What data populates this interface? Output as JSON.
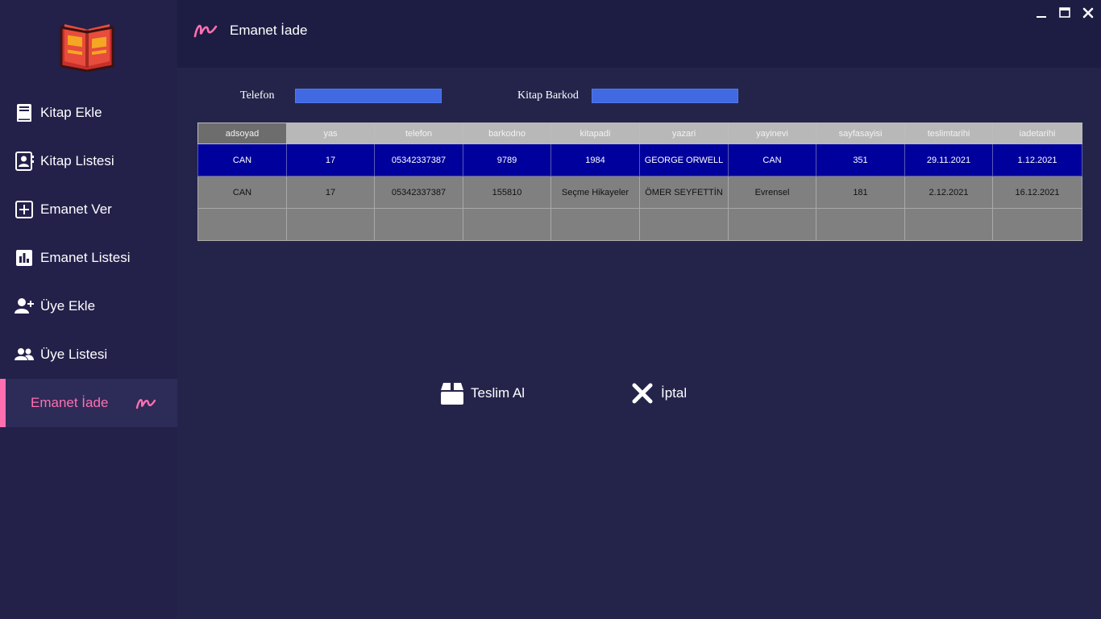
{
  "window": {
    "title": "Emanet İade"
  },
  "sidebar": {
    "items": [
      {
        "label": "Kitap Ekle",
        "icon": "book-icon"
      },
      {
        "label": "Kitap Listesi",
        "icon": "contact-list-icon"
      },
      {
        "label": "Emanet Ver",
        "icon": "plus-square-icon"
      },
      {
        "label": "Emanet Listesi",
        "icon": "bar-chart-icon"
      },
      {
        "label": "Üye Ekle",
        "icon": "user-plus-icon"
      },
      {
        "label": "Üye Listesi",
        "icon": "users-icon"
      },
      {
        "label": "Emanet İade",
        "icon": "squiggle-icon",
        "active": true
      }
    ]
  },
  "form": {
    "telefon_label": "Telefon",
    "telefon_value": "",
    "barkod_label": "Kitap Barkod",
    "barkod_value": ""
  },
  "table": {
    "columns": [
      "adsoyad",
      "yas",
      "telefon",
      "barkodno",
      "kitapadi",
      "yazari",
      "yayinevi",
      "sayfasayisi",
      "teslimtarihi",
      "iadetarihi"
    ],
    "rows": [
      [
        "CAN",
        "17",
        "05342337387",
        "9789",
        "1984",
        "GEORGE ORWELL",
        "CAN",
        "351",
        "29.11.2021",
        "1.12.2021"
      ],
      [
        "CAN",
        "17",
        "05342337387",
        "155810",
        "Seçme Hikayeler",
        "ÖMER SEYFETTİN",
        "Evrensel",
        "181",
        "2.12.2021",
        "16.12.2021"
      ]
    ]
  },
  "actions": {
    "teslim_label": "Teslim Al",
    "iptal_label": "İptal"
  },
  "colors": {
    "accent": "#ff6fb0",
    "input": "#4169e1",
    "selected_row": "#00009c"
  }
}
